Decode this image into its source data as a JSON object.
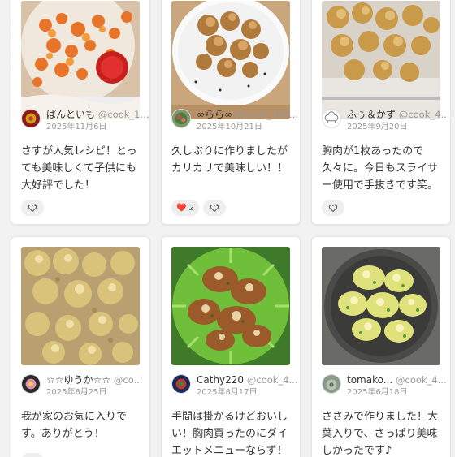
{
  "cards": [
    {
      "author": "ぱんといも",
      "handle": "@cook_1...",
      "date": "2025年11月6日",
      "comment": "さすが人気レシピ！とっても美味しくて子供にも大好評でした！",
      "photo_alt": "お皿に盛られた揚げ物とケチャップ",
      "avatar_icon": "avatar-photo-icon",
      "reactions": []
    },
    {
      "author": "∞らら∞",
      "handle": "@cook_400...",
      "date": "2025年10月21日",
      "comment": "久しぶりに作りましたがカリカリで美味しい！！",
      "photo_alt": "白い皿に盛られた唐揚げ",
      "avatar_icon": "avatar-plant-icon",
      "reactions": [
        {
          "emoji": "❤️",
          "count": "2"
        }
      ]
    },
    {
      "author": "ふぅ＆かず",
      "handle": "@cook_4...",
      "date": "2025年9月20日",
      "comment": "胸肉が1枚あったので久々に。今日もスライサー使用で手抜きです笑。ポ...",
      "photo_alt": "トレーに並んだかき揚げ",
      "avatar_icon": "chef-hat-icon",
      "reactions": []
    },
    {
      "author": "☆☆ゆうか☆☆",
      "handle": "@co...",
      "date": "2025年8月25日",
      "comment": "我が家のお気に入りです。ありがとう！",
      "photo_alt": "コーンの揚げ物のアップ",
      "avatar_icon": "avatar-flower-icon",
      "reactions": []
    },
    {
      "author": "Cathy220",
      "handle": "@cook_4...",
      "date": "2025年8月17日",
      "comment": "手間は掛かるけどおいしい！胸肉買ったのにダイエットメニューならず！",
      "photo_alt": "緑の皿に盛られたチーズ焼きチキン",
      "avatar_icon": "avatar-logo-icon",
      "reactions": []
    },
    {
      "author": "tomako...",
      "handle": "@cook_4...",
      "date": "2025年6月18日",
      "comment": "ささみで作りました！大葉入りで、さっぱり美味しかったです♪",
      "photo_alt": "黒い皿に盛られたコーンと大葉の焼き物",
      "avatar_icon": "avatar-photo-icon",
      "reactions": []
    }
  ],
  "ui": {
    "add_reaction_icon": "add-heart-icon"
  }
}
